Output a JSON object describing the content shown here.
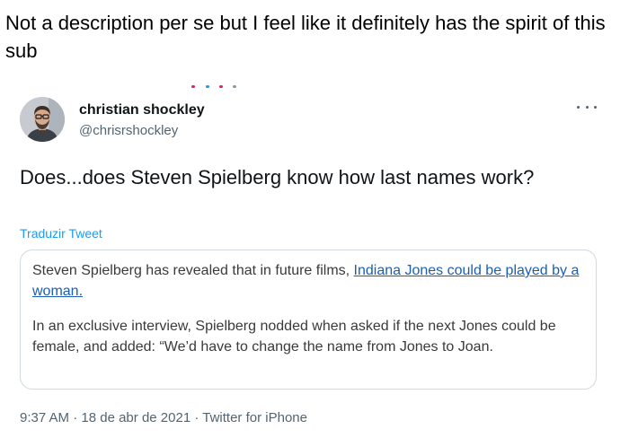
{
  "post": {
    "caption": "Not a description per se but I feel like it definitely has the spirit of this sub"
  },
  "colors": {
    "link": "#1d9bf0",
    "quote_link": "#1a5fb4",
    "secondary_text": "#536471",
    "border": "#cfd9de"
  },
  "tweet": {
    "author_name": "christian shockley",
    "author_handle": "@chrisrshockley",
    "more_icon": "ellipsis-icon",
    "text": "Does...does Steven Spielberg know how last names work?",
    "translate_label": "Traduzir Tweet",
    "quote": {
      "p1_before_link": "Steven Spielberg has revealed that in future films, ",
      "p1_link": "Indiana Jones could be played by a woman.",
      "p2": "In an exclusive interview, Spielberg nodded when asked if the next Jones could be female, and added: “We’d have to change the name from Jones to Joan."
    },
    "time": "9:37 AM",
    "date": "18 de abr de 2021",
    "separator": "·",
    "source": "Twitter for iPhone"
  }
}
